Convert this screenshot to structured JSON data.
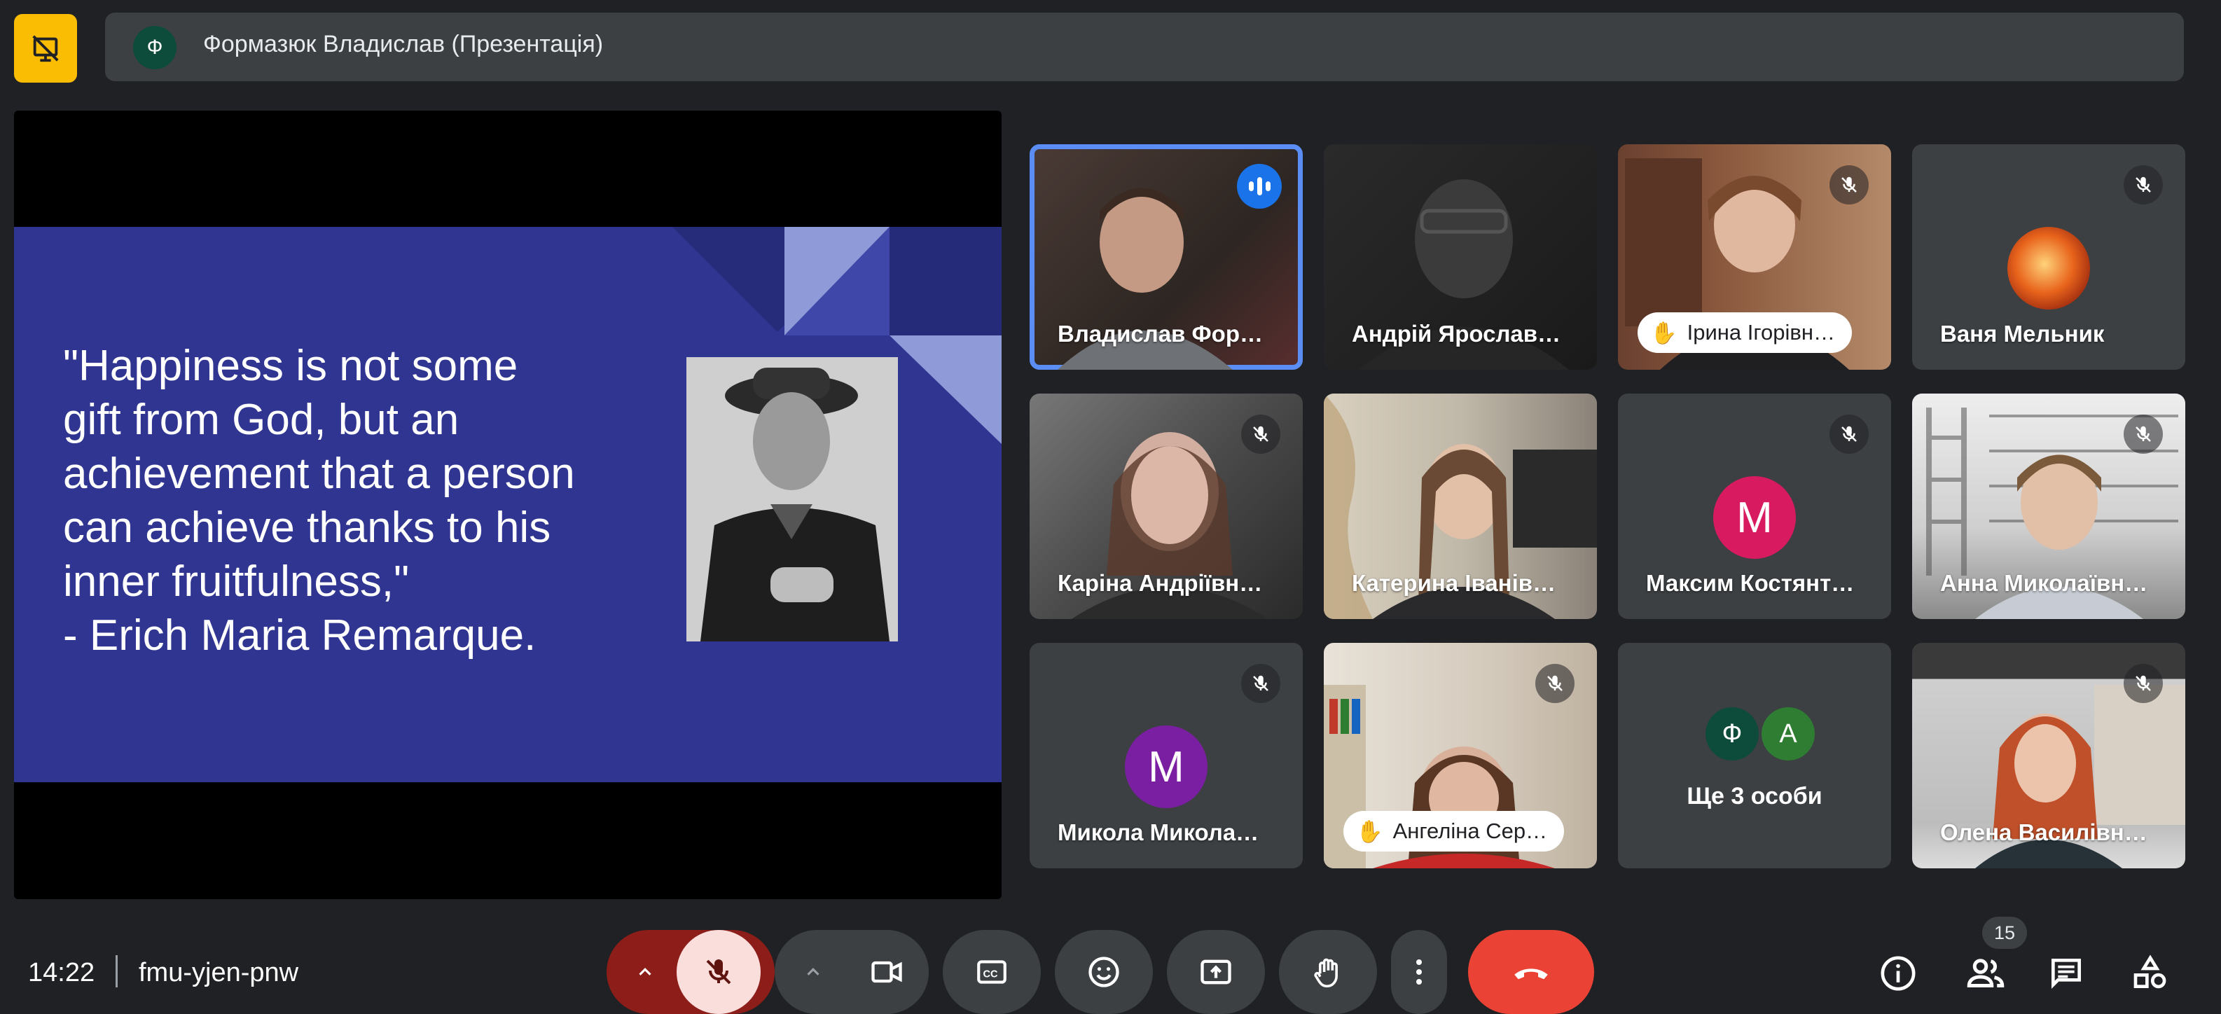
{
  "colors": {
    "accent": "#1a73e8",
    "end_call": "#ea4335",
    "muted_mic_bg": "#f9dedc",
    "brand_yellow": "#fbbc04"
  },
  "header": {
    "presenter_initial": "Ф",
    "presenter_title": "Формазюк Владислав (Презентація)"
  },
  "slide": {
    "quote": "\"Happiness is not some\ngift from God, but an\nachievement that a person\ncan achieve thanks to his\ninner fruitfulness,\"\n- Erich Maria Remarque."
  },
  "participants": [
    {
      "name": "Владислав Фор…",
      "state": "speaking"
    },
    {
      "name": "Андрій Ярослав…",
      "state": "video"
    },
    {
      "name": "Ірина Ігорівн…",
      "state": "hand-raised",
      "muted": true
    },
    {
      "name": "Ваня Мельник",
      "state": "avatar-image",
      "muted": true
    },
    {
      "name": "Каріна Андріївн…",
      "state": "video",
      "muted": true
    },
    {
      "name": "Катерина Іванів…",
      "state": "video"
    },
    {
      "name": "Максим Костянт…",
      "initial": "М",
      "color": "#d81b60",
      "muted": true
    },
    {
      "name": "Анна Миколаївн…",
      "state": "video",
      "muted": true
    },
    {
      "name": "Микола Микола…",
      "initial": "М",
      "color": "#7b1fa2",
      "muted": true
    },
    {
      "name": "Ангеліна Сер…",
      "state": "hand-raised",
      "muted": true
    },
    {
      "more_label": "Ще 3 особи",
      "initials": [
        "Ф",
        "А"
      ]
    },
    {
      "name": "Олена Василівн…",
      "state": "video",
      "muted": true
    }
  ],
  "footer": {
    "time": "14:22",
    "meeting_code": "fmu-yjen-pnw",
    "participant_count": "15"
  },
  "icons": [
    "no-present-icon",
    "mic-off-icon",
    "camera-icon",
    "captions-icon",
    "emoji-icon",
    "present-icon",
    "hand-icon",
    "more-vert-icon",
    "end-call-icon",
    "info-icon",
    "people-icon",
    "chat-icon",
    "activities-icon"
  ]
}
